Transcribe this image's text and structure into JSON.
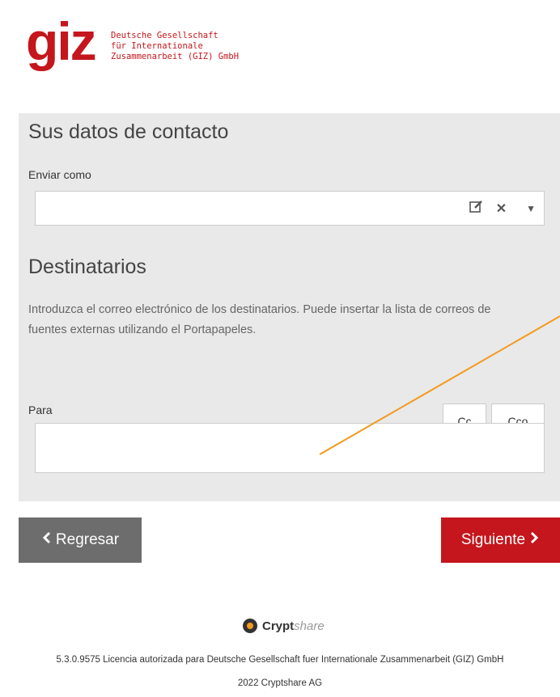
{
  "header": {
    "logo_mark": "giz",
    "logo_lines": [
      "Deutsche Gesellschaft",
      "für Internationale",
      "Zusammenarbeit (GIZ) GmbH"
    ]
  },
  "contact": {
    "title": "Sus datos de contacto",
    "send_as_label": "Enviar como",
    "send_as_value": "",
    "icons": [
      "edit-icon",
      "close-icon",
      "chevron-down-icon"
    ]
  },
  "recipients": {
    "title": "Destinatarios",
    "description": "Introduzca el correo electrónico de los destinatarios. Puede insertar la lista de correos de fuentes externas utilizando el Portapapeles.",
    "to_label": "Para",
    "cc_label": "Cc",
    "bcc_label": "Cco",
    "to_value": ""
  },
  "nav": {
    "back_label": "Regresar",
    "next_label": "Siguiente"
  },
  "footer": {
    "brand_main": "Crypt",
    "brand_suffix": "share",
    "license": "5.3.0.9575 Licencia autorizada para Deutsche Gesellschaft fuer Internationale Zusammenarbeit (GIZ) GmbH",
    "copyright": "2022 Cryptshare AG"
  },
  "colors": {
    "brand_red": "#c4161c",
    "panel_gray": "#e9e9e9",
    "back_gray": "#6d6d6d",
    "annotation_orange": "#f39a1d"
  }
}
